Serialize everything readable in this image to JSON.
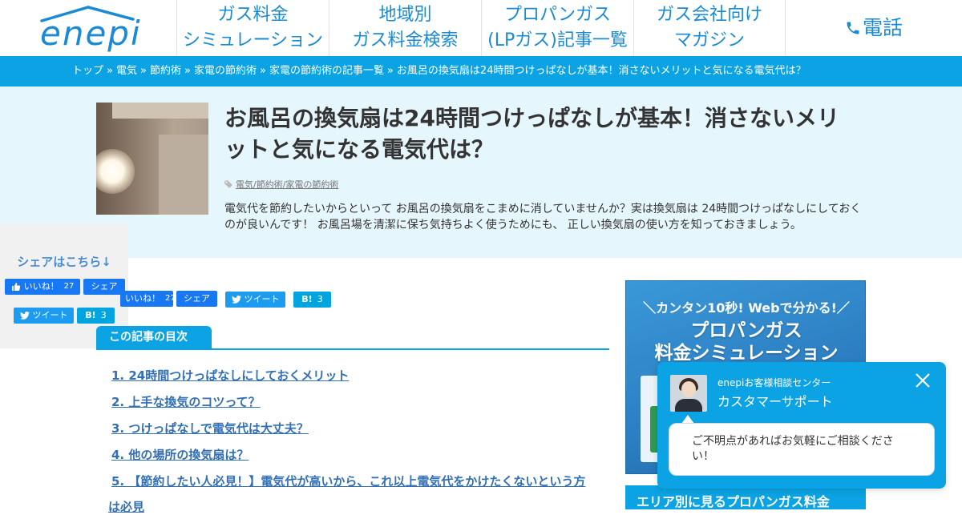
{
  "header": {
    "logo_text": "enepi",
    "nav": [
      {
        "line1": "ガス料金",
        "line2": "シミュレーション"
      },
      {
        "line1": "地域別",
        "line2": "ガス料金検索"
      },
      {
        "line1": "プロパンガス",
        "line2": "(LPガス)記事一覧"
      },
      {
        "line1": "ガス会社向け",
        "line2": "マガジン"
      }
    ],
    "phone_label": "電話",
    "brand_color": "#1a8ad4"
  },
  "breadcrumb": [
    "トップ",
    "電気",
    "節約術",
    "家電の節約術",
    "家電の節約術の記事一覧",
    "お風呂の換気扇は24時間つけっぱなしが基本！消さないメリットと気になる電気代は？"
  ],
  "breadcrumb_sep": "»",
  "article": {
    "title": "お風呂の換気扇は24時間つけっぱなしが基本！消さないメリットと気になる電気代は？",
    "tags": "電気/節約術/家電の節約術",
    "excerpt": "電気代を節約したいからといって お風呂の換気扇をこまめに消していませんか？実は換気扇は 24時間つけっぱなしにしておくのが良いんです！ お風呂場を清潔に保ち気持ちよく使うためにも、 正しい換気扇の使い方を知っておきましょう。"
  },
  "share_sidebar": {
    "title": "シェアはこちら↓",
    "like_label": "いいね！",
    "like_count": "27",
    "share_label": "シェア",
    "tweet_label": "ツイート",
    "hatena_label": "B!",
    "hatena_count": "3"
  },
  "share_bar": {
    "like_label": "いいね！",
    "like_count": "27",
    "share_label": "シェア",
    "tweet_label": "ツイート",
    "hatena_label": "B!",
    "hatena_count": "3"
  },
  "toc": {
    "heading": "この記事の目次",
    "items": [
      "1. 24時間つけっぱなしにしておくメリット",
      "2. 上手な換気のコツって？",
      "3. つけっぱなしで電気代は大丈夫？",
      "4. 他の場所の換気扇は？",
      "5. 【節約したい人必見！】電気代が高いから、これ以上電気代をかけたくないという方",
      "は必見"
    ]
  },
  "banner": {
    "top": "＼カンタン10秒! Webで分かる!／",
    "title_line1": "プロパンガス",
    "title_line2": "料金シミュレーション"
  },
  "area_box": "エリア別に見るプロパンガス料金",
  "chat": {
    "org": "enepiお客様相談センター",
    "name": "カスタマーサポート",
    "message": "ご不明点があればお気軽にご相談ください！"
  }
}
